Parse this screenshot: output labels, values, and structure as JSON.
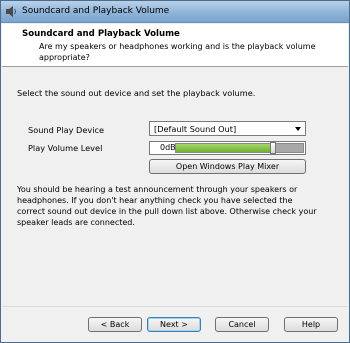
{
  "window": {
    "title": "Soundcard and Playback Volume"
  },
  "header": {
    "title": "Soundcard and Playback Volume",
    "subtitle": "Are my speakers or headphones working and is the playback volume appropriate?"
  },
  "instruction": "Select the sound out device and set the playback volume.",
  "device": {
    "label": "Sound Play Device",
    "selected": "[Default Sound Out]"
  },
  "volume": {
    "label": "Play Volume Level",
    "readout": "0dB",
    "level": 0.76,
    "fill_color": "#7cbf3c"
  },
  "mixer_button": "Open Windows Play Mixer",
  "description": "You should be hearing a test announcement through your speakers or headphones. If you don't hear anything check you have selected the correct sound out device in the pull down list above. Otherwise check your speaker leads are connected.",
  "footer": {
    "back": "< Back",
    "next": "Next >",
    "cancel": "Cancel",
    "help": "Help"
  },
  "icons": {
    "title_icon": "speaker-icon",
    "combo_arrow": "chevron-down-icon"
  }
}
